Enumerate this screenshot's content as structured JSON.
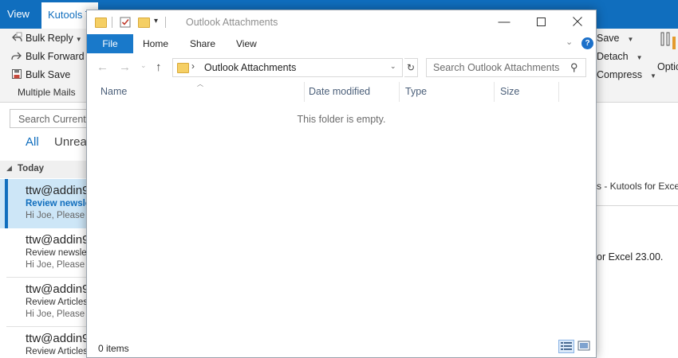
{
  "outlook": {
    "tabs": {
      "view": "View",
      "kutools": "Kutools T"
    },
    "ribbon": {
      "bulk_reply": "Bulk Reply",
      "bulk_forward": "Bulk Forward",
      "bulk_save": "Bulk Save",
      "group_label": "Multiple Mails",
      "save": "Save",
      "detach": "Detach",
      "compress": "Compress",
      "options": "Optic",
      "right_group_label": "s"
    },
    "search_placeholder": "Search Current M",
    "filters": {
      "all": "All",
      "unread": "Unread"
    },
    "today_label": "Today",
    "mails": [
      {
        "from": "ttw@addin9",
        "subject": "Review newsle",
        "preview": "Hi Joe,  Please"
      },
      {
        "from": "ttw@addin9",
        "subject": "Review newslet",
        "preview": "Hi Joe,  Please"
      },
      {
        "from": "ttw@addin9",
        "subject": "Review Articles",
        "preview": "Hi Joe,  Please"
      },
      {
        "from": "ttw@addin9",
        "subject": "Review Articles",
        "preview": ""
      }
    ],
    "reading_title": "s - Kutools for Excel",
    "reading_body": "or Excel 23.00."
  },
  "explorer": {
    "title": "Outlook Attachments",
    "ribbon_tabs": {
      "file": "File",
      "home": "Home",
      "share": "Share",
      "view": "View"
    },
    "help": "?",
    "address": "Outlook Attachments",
    "search_placeholder": "Search Outlook Attachments",
    "columns": {
      "name": "Name",
      "date_modified": "Date modified",
      "type": "Type",
      "size": "Size"
    },
    "empty_message": "This folder is empty.",
    "status": "0 items"
  },
  "colors": {
    "outlook_accent": "#106ebe",
    "file_tab": "#1979ca",
    "selected_mail_bar": "#106ebe"
  }
}
